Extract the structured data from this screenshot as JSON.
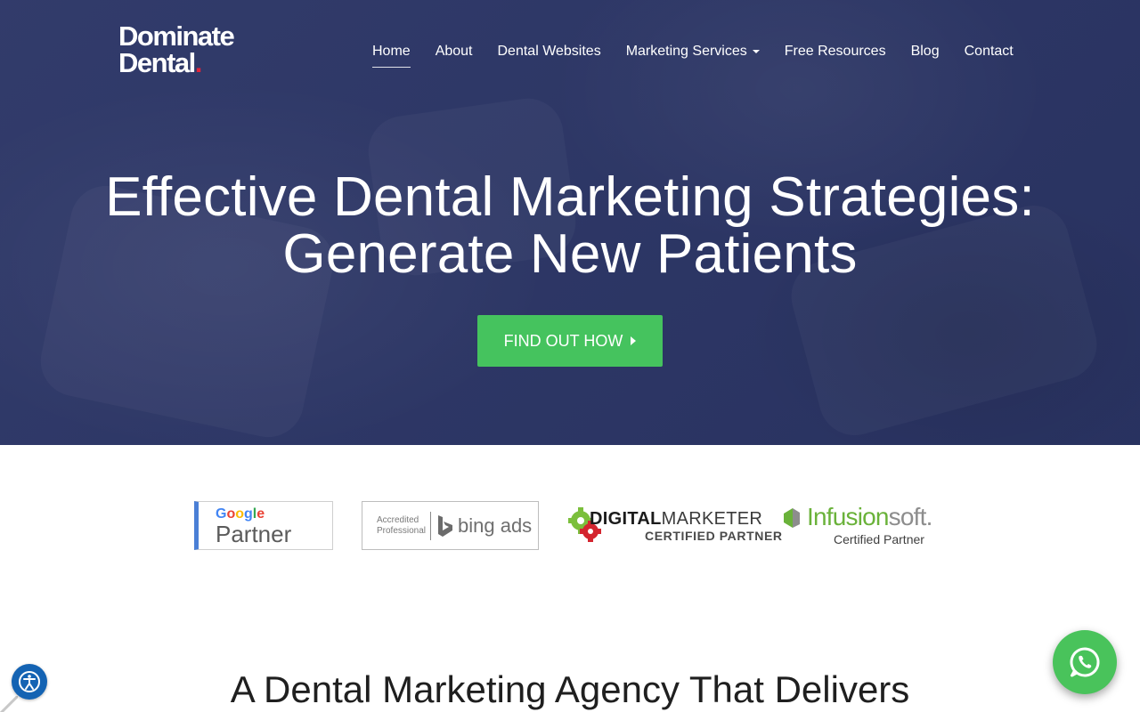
{
  "brand": {
    "logo_line1": "Dominate",
    "logo_line2": "Dental",
    "logo_dot": ".",
    "accent_red": "#e0243a",
    "hero_bg": "#2b3566",
    "cta_green": "#45c35e"
  },
  "nav": {
    "items": [
      {
        "label": "Home",
        "active": true
      },
      {
        "label": "About"
      },
      {
        "label": "Dental Websites"
      },
      {
        "label": "Marketing Services",
        "dropdown": true
      },
      {
        "label": "Free Resources"
      },
      {
        "label": "Blog"
      },
      {
        "label": "Contact"
      }
    ]
  },
  "hero": {
    "headline_line1": "Effective Dental Marketing Strategies:",
    "headline_line2": "Generate New Patients",
    "cta_label": "FIND OUT HOW",
    "cta_icon": "caret-right-icon"
  },
  "partners": {
    "google": {
      "word_letters": [
        "G",
        "o",
        "o",
        "g",
        "l",
        "e"
      ],
      "label": "Partner"
    },
    "bing": {
      "accredited_line1": "Accredited",
      "accredited_line2": "Professional",
      "label": "bing ads",
      "icon": "bing-icon"
    },
    "digital_marketer": {
      "word1": "DIGITAL",
      "word2": "MARKETER",
      "sub": "CERTIFIED PARTNER",
      "icon": "gear-icon"
    },
    "infusionsoft": {
      "word1": "Infusion",
      "word2": "soft.",
      "sub": "Certified Partner",
      "icon": "infusionsoft-icon"
    }
  },
  "section": {
    "heading": "A Dental Marketing Agency That Delivers"
  },
  "floating": {
    "accessibility_icon": "accessibility-icon",
    "whatsapp_icon": "whatsapp-icon"
  }
}
